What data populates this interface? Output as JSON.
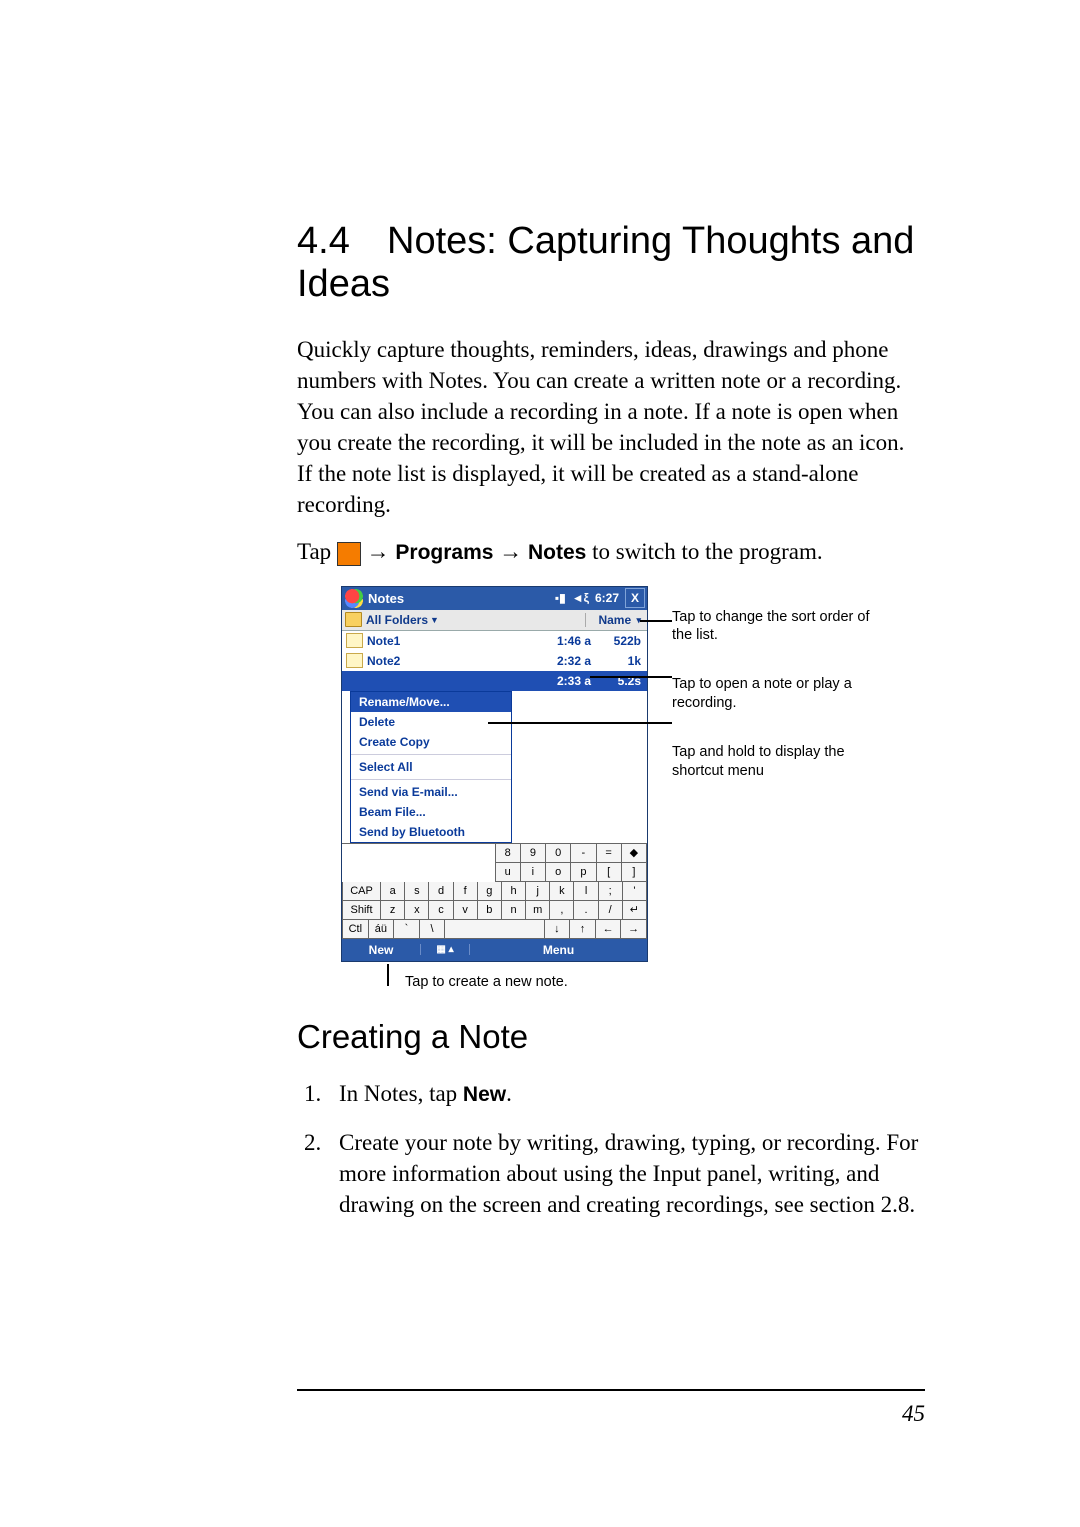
{
  "heading": {
    "number": "4.4",
    "title": "Notes: Capturing Thoughts and Ideas"
  },
  "intro": "Quickly capture thoughts, reminders, ideas, drawings and phone numbers with Notes. You can create a written note or a recording. You can also include a recording in a note. If a note is open when you create the recording, it will be included in the note as an icon. If the note list is displayed, it will be created as a stand-alone recording.",
  "nav": {
    "pre": "Tap ",
    "arrow": "→",
    "programs": "Programs",
    "notes": "Notes",
    "post": " to switch to the program."
  },
  "phone": {
    "titlebar": {
      "app": "Notes",
      "time": "6:27",
      "signal": "▪▮",
      "sound": "◄ξ",
      "close": "X"
    },
    "header": {
      "folders": "All Folders",
      "tri": "▼",
      "name": "Name",
      "tri2": "▾"
    },
    "rows": [
      {
        "name": "Note1",
        "time": "1:46 a",
        "size": "522b"
      },
      {
        "name": "Note2",
        "time": "2:32 a",
        "size": "1k"
      },
      {
        "name": "",
        "time": "2:33 a",
        "size": "5.2s",
        "sel": true
      }
    ],
    "context": [
      "Rename/Move...",
      "Delete",
      "Create Copy",
      "Select All",
      "Send via E-mail...",
      "Beam File...",
      "Send by Bluetooth"
    ],
    "sip": {
      "r1": [
        "8",
        "9",
        "0",
        "-",
        "=",
        "◆"
      ],
      "r2": [
        "u",
        "i",
        "o",
        "p",
        "[",
        "]"
      ],
      "r3": [
        "CAP",
        "a",
        "s",
        "d",
        "f",
        "g",
        "h",
        "j",
        "k",
        "l",
        ";",
        "'"
      ],
      "r4": [
        "Shift",
        "z",
        "x",
        "c",
        "v",
        "b",
        "n",
        "m",
        ",",
        ".",
        "/",
        "↵"
      ],
      "r5": [
        "Ctl",
        "áü",
        "`",
        "\\",
        " ",
        "↓",
        "↑",
        "←",
        "→"
      ]
    },
    "bottombar": {
      "new": "New",
      "kbd": "▦ ▴",
      "menu": "Menu"
    }
  },
  "annotations": {
    "a1": "Tap to change the sort order of the list.",
    "a2": "Tap to open a note or play a recording.",
    "a3": "Tap and hold to display the shortcut menu",
    "newnote": "Tap to create a new note."
  },
  "subheading": "Creating a Note",
  "steps": {
    "s1_pre": "In Notes, tap ",
    "s1_b": "New",
    "s1_post": ".",
    "s2": "Create your note by writing, drawing, typing, or recording. For more information about using the Input panel, writing, and drawing on the screen and creating recordings, see section 2.8."
  },
  "page_number": "45"
}
